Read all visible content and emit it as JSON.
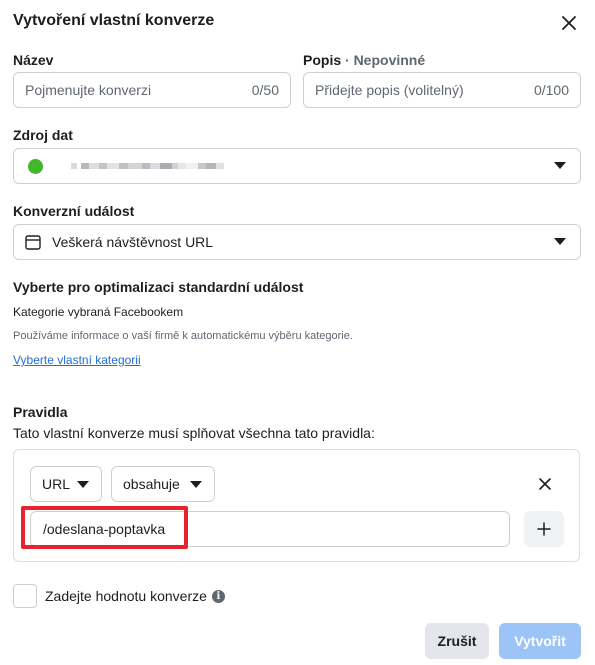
{
  "dialog": {
    "title": "Vytvoření vlastní konverze",
    "close_icon": "close-icon"
  },
  "name_field": {
    "label": "Název",
    "placeholder": "Pojmenujte konverzi",
    "counter": "0/50"
  },
  "description_field": {
    "label": "Popis",
    "optional": "· Nepovinné",
    "placeholder": "Přidejte popis (volitelný)",
    "counter": "0/100"
  },
  "data_source": {
    "label": "Zdroj dat",
    "status_color": "#42b72a",
    "icon": "chevron-down-icon"
  },
  "conversion_event": {
    "label": "Konverzní událost",
    "icon": "calendar-icon",
    "value": "Veškerá návštěvnost URL"
  },
  "optimization": {
    "label": "Vyberte pro optimalizaci standardní událost",
    "category_text": "Kategorie vybraná Facebookem",
    "info_text": "Používáme informace o vaší firmě k automatickému výběru kategorie.",
    "link_text": "Vyberte vlastní kategorii"
  },
  "rules": {
    "label": "Pravidla",
    "description": "Tato vlastní konverze musí splňovat všechna tato pravidla:",
    "field_dropdown": "URL",
    "operator_dropdown": "obsahuje",
    "value": "/odeslana-poptavka",
    "highlight_color": "#e5242f"
  },
  "conversion_value": {
    "label": "Zadejte hodnotu konverze",
    "info_icon": "info-icon"
  },
  "actions": {
    "cancel": "Zrušit",
    "create": "Vytvořit",
    "create_color": "#9cc4f7"
  }
}
